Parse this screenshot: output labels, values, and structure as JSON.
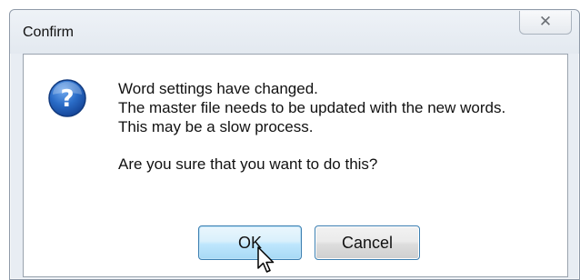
{
  "window": {
    "title": "Confirm",
    "close_icon": "close-icon"
  },
  "message": {
    "lines": [
      "Word settings have changed.",
      "The master file needs to be updated with the new words.",
      "This may be a slow process."
    ],
    "question": "Are you sure that  you want to do this?"
  },
  "icons": {
    "dialog_icon": "question-icon",
    "cursor": "mouse-pointer-icon"
  },
  "buttons": {
    "ok_label": "OK",
    "cancel_label": "Cancel"
  },
  "colors": {
    "icon_blue": "#1f5fb8",
    "button_border": "#3c7fb1"
  }
}
